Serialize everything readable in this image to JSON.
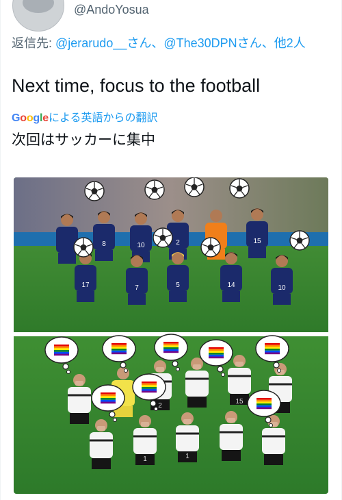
{
  "user": {
    "handle": "@AndoYosua"
  },
  "reply": {
    "prefix": "返信先: ",
    "mention_1": "@jerarudo__さん",
    "separator_1": "、",
    "mention_2": "@The30DPNさん",
    "separator_2": "、",
    "others": "他2人"
  },
  "tweet": {
    "text": "Next time, focus to the football",
    "translation_label": "による英語からの翻訳",
    "translated_text": "次回はサッカーに集中"
  },
  "media": {
    "top_team_jersey_numbers": [
      "8",
      "10",
      "2",
      "15",
      "17",
      "7",
      "5",
      "14",
      "10"
    ],
    "bottom_team_jersey_numbers": [
      "2",
      "15",
      "1",
      "1"
    ]
  },
  "colors": {
    "link": "#1d9bf0",
    "secondary_text": "#536471",
    "japan_kit": "#1b2a6b",
    "germany_kit": "#f4f4f4"
  }
}
